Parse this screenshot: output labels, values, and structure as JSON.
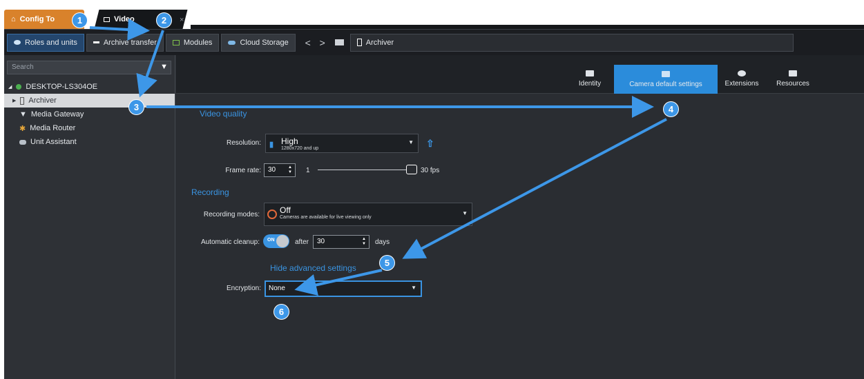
{
  "tabs": {
    "config": "Config To",
    "video": "Video",
    "close": "×"
  },
  "toolbar": {
    "roles": "Roles and units",
    "archive": "Archive transfer",
    "modules": "Modules",
    "cloud": "Cloud Storage",
    "back": "<",
    "forward": ">",
    "archiver": "Archiver"
  },
  "sidebar": {
    "search_placeholder": "Search",
    "root": "DESKTOP-LS304OE",
    "items": [
      {
        "label": "Archiver"
      },
      {
        "label": "Media Gateway"
      },
      {
        "label": "Media Router"
      },
      {
        "label": "Unit Assistant"
      }
    ]
  },
  "main_tabs": {
    "identity": "Identity",
    "camera": "Camera default settings",
    "extensions": "Extensions",
    "resources": "Resources"
  },
  "form": {
    "video_quality": "Video quality",
    "resolution_label": "Resolution:",
    "resolution_value": "High",
    "resolution_sub": "1280x720 and up",
    "framerate_label": "Frame rate:",
    "framerate_value": "30",
    "framerate_min": "1",
    "framerate_max": "30 fps",
    "recording_section": "Recording",
    "recording_modes_label": "Recording modes:",
    "recording_value": "Off",
    "recording_sub": "Cameras are available for live viewing only",
    "cleanup_label": "Automatic cleanup:",
    "cleanup_toggle": "ON",
    "cleanup_after": "after",
    "cleanup_value": "30",
    "cleanup_days": "days",
    "hide_advanced": "Hide advanced settings",
    "encryption_label": "Encryption:",
    "encryption_value": "None"
  },
  "annotations": {
    "badges": [
      "1",
      "2",
      "3",
      "4",
      "5",
      "6"
    ],
    "color": "#3d97e8"
  }
}
